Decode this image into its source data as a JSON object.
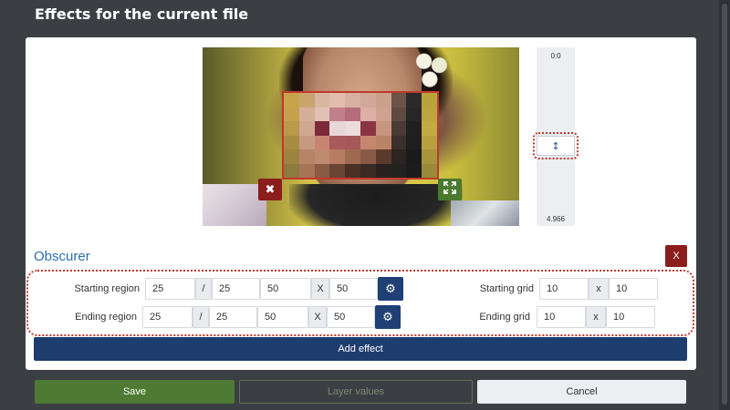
{
  "dialog": {
    "title": "Effects for the current file"
  },
  "timeline": {
    "start_time": "0:0",
    "end_time": "4.966",
    "handle_icon": "vertical-arrows-icon"
  },
  "effect": {
    "name": "Obscurer",
    "close_label": "X",
    "remove_box_icon": "close-icon",
    "resize_box_icon": "expand-icon",
    "mosaic_grid": {
      "columns": 10,
      "rows": 6
    },
    "starting_region": {
      "label": "Starting region",
      "x": "25",
      "separator": "/",
      "y": "25",
      "width": "50",
      "times": "X",
      "height": "50",
      "settings_icon": "gear-icon"
    },
    "ending_region": {
      "label": "Ending region",
      "x": "25",
      "separator": "/",
      "y": "25",
      "width": "50",
      "times": "X",
      "height": "50",
      "settings_icon": "gear-icon"
    },
    "starting_grid": {
      "label": "Starting grid",
      "columns": "10",
      "times": "x",
      "rows": "10"
    },
    "ending_grid": {
      "label": "Ending grid",
      "columns": "10",
      "times": "x",
      "rows": "10"
    },
    "add_effect_label": "Add effect"
  },
  "footer": {
    "save_label": "Save",
    "layer_values_label": "Layer values",
    "cancel_label": "Cancel"
  },
  "colors": {
    "background": "#3b3f44",
    "primary": "#1e3d6f",
    "danger": "#8b1d1d",
    "success": "#4e7a34",
    "accent_title": "#2a6fb0"
  }
}
